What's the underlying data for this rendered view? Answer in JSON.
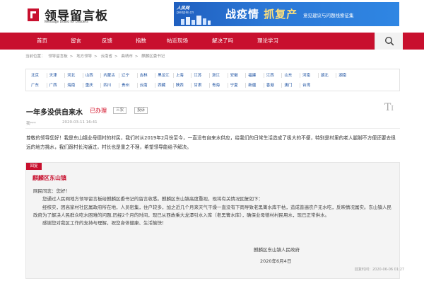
{
  "header": {
    "logo_title": "领导留言板",
    "logo_subtitle": "Message Board for Leaders",
    "banner": {
      "brand": "人民网",
      "brand_sub": "people.cn",
      "headline_a": "战疫情",
      "headline_b": "抓复产",
      "note": "意见建议与问题线索征集"
    },
    "brand_color": "#c8102e"
  },
  "nav": {
    "items": [
      "首页",
      "留言",
      "反馈",
      "指数",
      "帖近现场",
      "解决了吗",
      "理论学习"
    ],
    "search_icon": "search-icon"
  },
  "breadcrumb": {
    "prefix": "当前位置：",
    "items": [
      "领导留言板",
      "地方领导",
      "云南省",
      "曲靖市",
      "麒麟区委书记"
    ]
  },
  "regions": {
    "row1": [
      "北京",
      "天津",
      "河北",
      "山西",
      "内蒙古",
      "辽宁",
      "吉林",
      "黑龙江",
      "上海",
      "江苏",
      "浙江",
      "安徽",
      "福建",
      "江西",
      "山东",
      "河南",
      "湖北",
      "湖南"
    ],
    "row2": [
      "广东",
      "广西",
      "海南",
      "重庆",
      "四川",
      "贵州",
      "云南",
      "西藏",
      "陕西",
      "甘肃",
      "青海",
      "宁夏",
      "新疆",
      "香港",
      "澳门",
      "台湾"
    ]
  },
  "message": {
    "title": "一年多没供自来水",
    "status": "已办理",
    "tags": [
      "三农",
      "投诉"
    ],
    "font_icon": "font-size-icon",
    "author": "我***",
    "date": "2020-03-11 16:41",
    "body": "尊敬的领导您好！我是东山镇业母德村的村民，我们村从2019年2月份至今，一直没有自来水供应，给我们的日常生活造成了极大的不便，特别是村里的老人腿脚不方便还要去很远的地方挑水，我们跟村长沟通过，村长也是重之不理，希望领导能给予解决。"
  },
  "reply": {
    "tab": "回复",
    "org": "麒麟区东山镇",
    "greeting": "网民同志：您好！",
    "paragraphs": [
      "您通过人民网地方领导留言板给麒麟区委书记的留言收悉。麒麟区东山镇高度重视，现将有关情况回复如下：",
      "经核实，因高家村社区属政府所在地，人员密集，住户较多，加之近几个月来天气干燥一直没有下雨导致老黑箐水库干枯，造成普遍农户无水吃，反映情况属实。东山镇人民政府为了解决人民群众吃水困难的问题,历经2个月的时间，现已从西故乘大龙潭引水入库（老黑箐水库），确保业母德村村民用水，现已正常供水。",
      "感谢您对我区工作的支持与理解，祝您身体健康、生活愉快！"
    ],
    "signature": "麒麟区东山镇人民政府",
    "sign_date": "2020年6月4日",
    "reply_time": "回复时间：2020-06-06 01:27"
  }
}
